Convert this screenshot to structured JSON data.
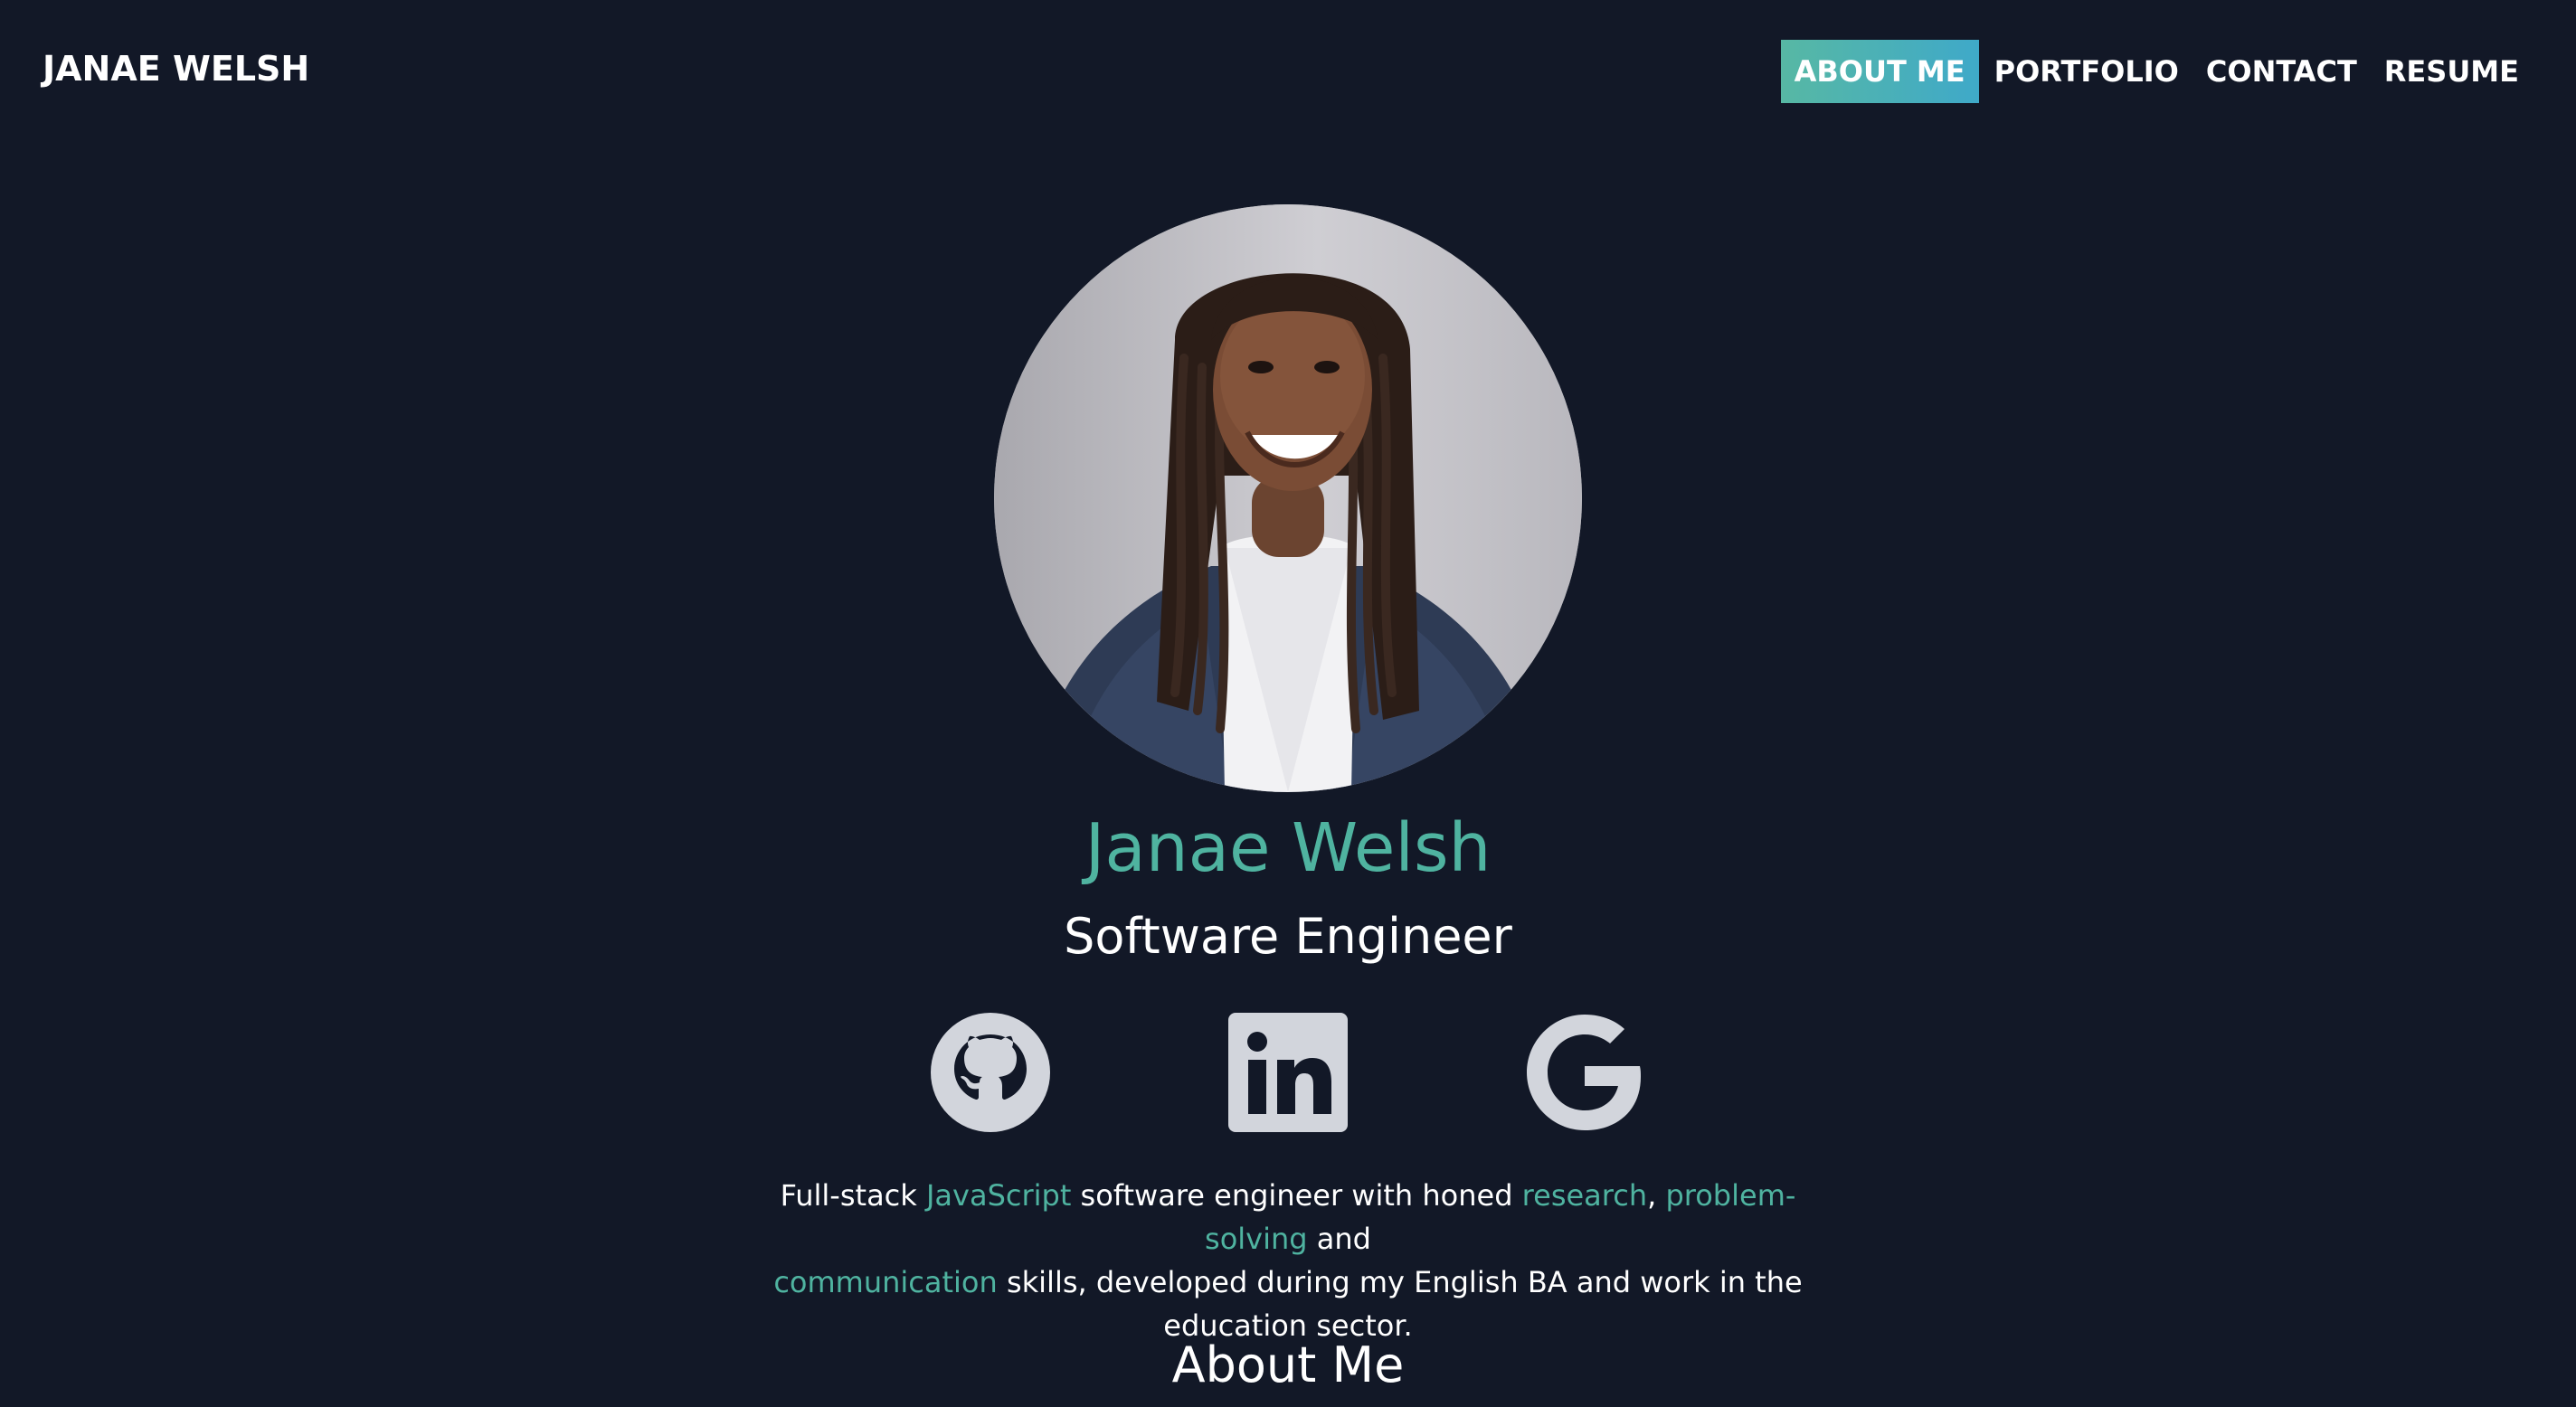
{
  "header": {
    "brand": "JANAE WELSH",
    "nav": [
      {
        "label": "ABOUT ME",
        "active": true
      },
      {
        "label": "PORTFOLIO",
        "active": false
      },
      {
        "label": "CONTACT",
        "active": false
      },
      {
        "label": "RESUME",
        "active": false
      }
    ]
  },
  "profile": {
    "name": "Janae Welsh",
    "title": "Software Engineer"
  },
  "socials": [
    {
      "name": "github",
      "icon": "github-icon"
    },
    {
      "name": "linkedin",
      "icon": "linkedin-icon"
    },
    {
      "name": "google",
      "icon": "google-icon"
    }
  ],
  "bio": {
    "t1": "Full-stack ",
    "h1": "JavaScript",
    "t2": " software engineer with honed ",
    "h2": "research",
    "t3": ", ",
    "h3": "problem-solving",
    "t4": " and ",
    "h4": "communication",
    "t5": " skills, developed during my English BA and work in the education sector."
  },
  "sections": {
    "about_heading": "About Me"
  },
  "colors": {
    "background": "#121827",
    "accent": "#4fb3a0",
    "nav_active_gradient_start": "#57b8a4",
    "nav_active_gradient_end": "#3fa9c9",
    "icon": "#d2d5dc"
  }
}
